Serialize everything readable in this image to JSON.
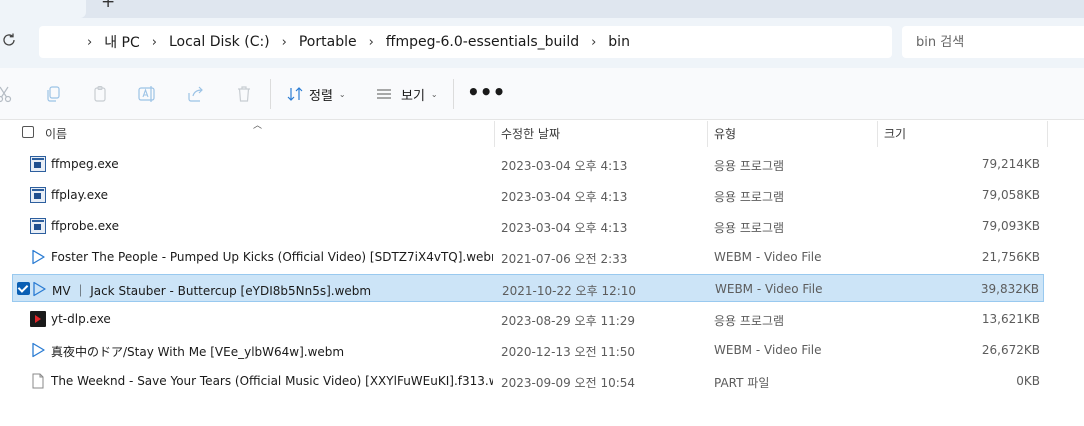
{
  "window": {
    "tab_close_glyph": "✕",
    "new_tab_glyph": "+"
  },
  "address": {
    "breadcrumbs": [
      "내 PC",
      "Local Disk (C:)",
      "Portable",
      "ffmpeg-6.0-essentials_build",
      "bin"
    ],
    "search_placeholder": "bin 검색"
  },
  "toolbar": {
    "sort_label": "정렬",
    "view_label": "보기",
    "more_label": "•••",
    "icons": [
      "cut-icon",
      "copy-icon",
      "paste-icon",
      "rename-icon",
      "share-icon",
      "delete-icon"
    ]
  },
  "columns": {
    "name": "이름",
    "date": "수정한 날짜",
    "type": "유형",
    "size": "크기"
  },
  "files": [
    {
      "name": "ffmpeg.exe",
      "date": "2023-03-04 오후 4:13",
      "type": "응용 프로그램",
      "size": "79,214KB",
      "icon": "exe-icon",
      "selected": false
    },
    {
      "name": "ffplay.exe",
      "date": "2023-03-04 오후 4:13",
      "type": "응용 프로그램",
      "size": "79,058KB",
      "icon": "exe-icon",
      "selected": false
    },
    {
      "name": "ffprobe.exe",
      "date": "2023-03-04 오후 4:13",
      "type": "응용 프로그램",
      "size": "79,093KB",
      "icon": "exe-icon",
      "selected": false
    },
    {
      "name": "Foster The People - Pumped Up Kicks (Official Video) [SDTZ7iX4vTQ].webm",
      "date": "2021-07-06 오전 2:33",
      "type": "WEBM - Video File",
      "size": "21,756KB",
      "icon": "video-play-icon",
      "selected": false
    },
    {
      "name": "MV ｜ Jack Stauber - Buttercup [eYDI8b5Nn5s].webm",
      "date": "2021-10-22 오후 12:10",
      "type": "WEBM - Video File",
      "size": "39,832KB",
      "icon": "video-play-icon",
      "selected": true
    },
    {
      "name": "yt-dlp.exe",
      "date": "2023-08-29 오후 11:29",
      "type": "응용 프로그램",
      "size": "13,621KB",
      "icon": "yt-dlp-icon",
      "selected": false
    },
    {
      "name": "真夜中のドア/Stay With Me [VEe_ylbW64w].webm",
      "date": "2020-12-13 오전 11:50",
      "type": "WEBM - Video File",
      "size": "26,672KB",
      "icon": "video-play-icon",
      "selected": false
    },
    {
      "name": "The Weeknd - Save Your Tears (Official Music Video) [XXYlFuWEuKI].f313.web...",
      "date": "2023-09-09 오전 10:54",
      "type": "PART 파일",
      "size": "0KB",
      "icon": "blank-file-icon",
      "selected": false
    }
  ],
  "colors": {
    "selection_bg": "#cce4f7",
    "selection_border": "#99c9ef",
    "accent": "#0a5fb4"
  }
}
